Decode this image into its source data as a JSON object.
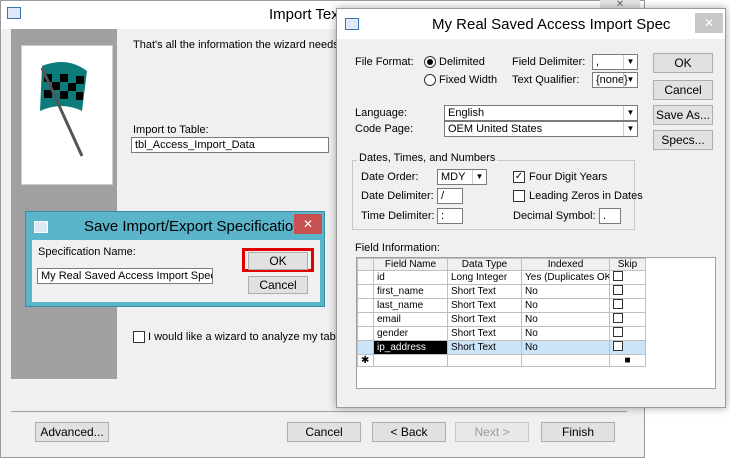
{
  "wizard": {
    "title": "Import Text Wizard",
    "info_text": "That's all the information the wizard needs to import",
    "import_label": "Import to Table:",
    "import_value": "tbl_Access_Import_Data",
    "analyze_label": "I would like a wizard to analyze my table after imp",
    "advanced": "Advanced...",
    "cancel": "Cancel",
    "back": "< Back",
    "next": "Next >",
    "finish": "Finish"
  },
  "spec": {
    "title": "My Real Saved Access Import Spec",
    "file_format": "File Format:",
    "delimited": "Delimited",
    "fixed_width": "Fixed Width",
    "field_delim_label": "Field Delimiter:",
    "field_delim_value": ",",
    "text_qual_label": "Text Qualifier:",
    "text_qual_value": "{none}",
    "ok": "OK",
    "cancel": "Cancel",
    "save_as": "Save As...",
    "specs": "Specs...",
    "language_label": "Language:",
    "language_value": "English",
    "codepage_label": "Code Page:",
    "codepage_value": "OEM United States",
    "dates_group": "Dates, Times, and Numbers",
    "date_order_label": "Date Order:",
    "date_order_value": "MDY",
    "date_delim_label": "Date Delimiter:",
    "date_delim_value": "/",
    "time_delim_label": "Time Delimiter:",
    "time_delim_value": ":",
    "four_digit": "Four Digit Years",
    "leading_zeros": "Leading Zeros in Dates",
    "decimal_label": "Decimal Symbol:",
    "decimal_value": ".",
    "field_info": "Field Information:",
    "columns": [
      "Field Name",
      "Data Type",
      "Indexed",
      "Skip"
    ],
    "rows": [
      [
        "id",
        "Long Integer",
        "Yes (Duplicates OK)"
      ],
      [
        "first_name",
        "Short Text",
        "No"
      ],
      [
        "last_name",
        "Short Text",
        "No"
      ],
      [
        "email",
        "Short Text",
        "No"
      ],
      [
        "gender",
        "Short Text",
        "No"
      ],
      [
        "ip_address",
        "Short Text",
        "No"
      ]
    ],
    "new_row_marker": "✱"
  },
  "save": {
    "title": "Save Import/Export Specification",
    "name_label": "Specification Name:",
    "name_value": "My Real Saved Access Import Spec",
    "ok": "OK",
    "cancel": "Cancel"
  }
}
